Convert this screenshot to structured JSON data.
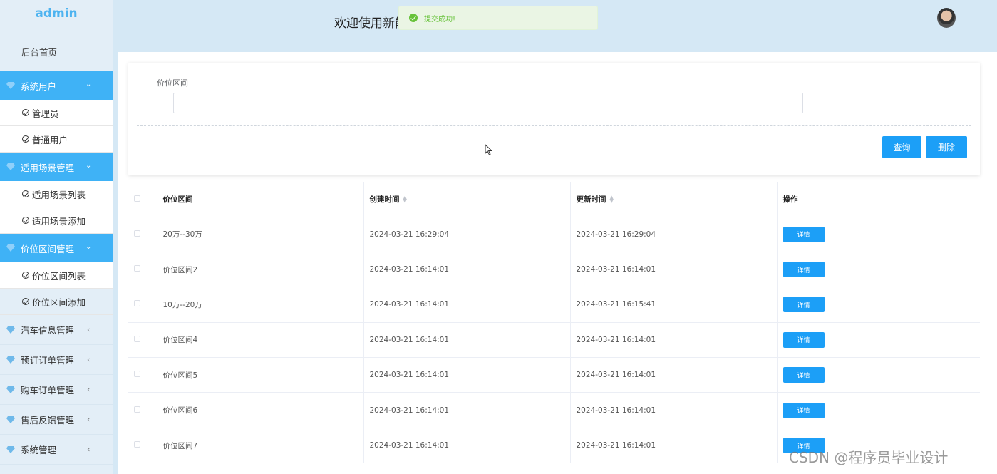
{
  "sidebar": {
    "logo": "admin",
    "home": "后台首页",
    "groups": [
      {
        "label": "系统用户",
        "items": [
          "管理员",
          "普通用户"
        ]
      },
      {
        "label": "适用场景管理",
        "items": [
          "适用场景列表",
          "适用场景添加"
        ]
      },
      {
        "label": "价位区间管理",
        "items": [
          "价位区间列表",
          "价位区间添加"
        ]
      }
    ],
    "collapsed": [
      "汽车信息管理",
      "预订订单管理",
      "购车订单管理",
      "售后反馈管理",
      "系统管理"
    ]
  },
  "header": {
    "title": "欢迎使用新能",
    "toast": "提交成功!"
  },
  "search": {
    "label": "价位区间",
    "value": "",
    "query_label": "查询",
    "delete_label": "删除"
  },
  "table": {
    "headers": [
      "价位区间",
      "创建时间",
      "更新时间",
      "操作"
    ],
    "detail_label": "详情",
    "rows": [
      [
        "20万--30万",
        "2024-03-21 16:29:04",
        "2024-03-21 16:29:04"
      ],
      [
        "价位区间2",
        "2024-03-21 16:14:01",
        "2024-03-21 16:14:01"
      ],
      [
        "10万--20万",
        "2024-03-21 16:14:01",
        "2024-03-21 16:15:41"
      ],
      [
        "价位区间4",
        "2024-03-21 16:14:01",
        "2024-03-21 16:14:01"
      ],
      [
        "价位区间5",
        "2024-03-21 16:14:01",
        "2024-03-21 16:14:01"
      ],
      [
        "价位区间6",
        "2024-03-21 16:14:01",
        "2024-03-21 16:14:01"
      ],
      [
        "价位区间7",
        "2024-03-21 16:14:01",
        "2024-03-21 16:14:01"
      ]
    ]
  },
  "watermark": "CSDN @程序员毕业设计",
  "colors": {
    "accent": "#1c9ff7",
    "menu_active": "#3fb2f6",
    "success": "#67c23a"
  }
}
